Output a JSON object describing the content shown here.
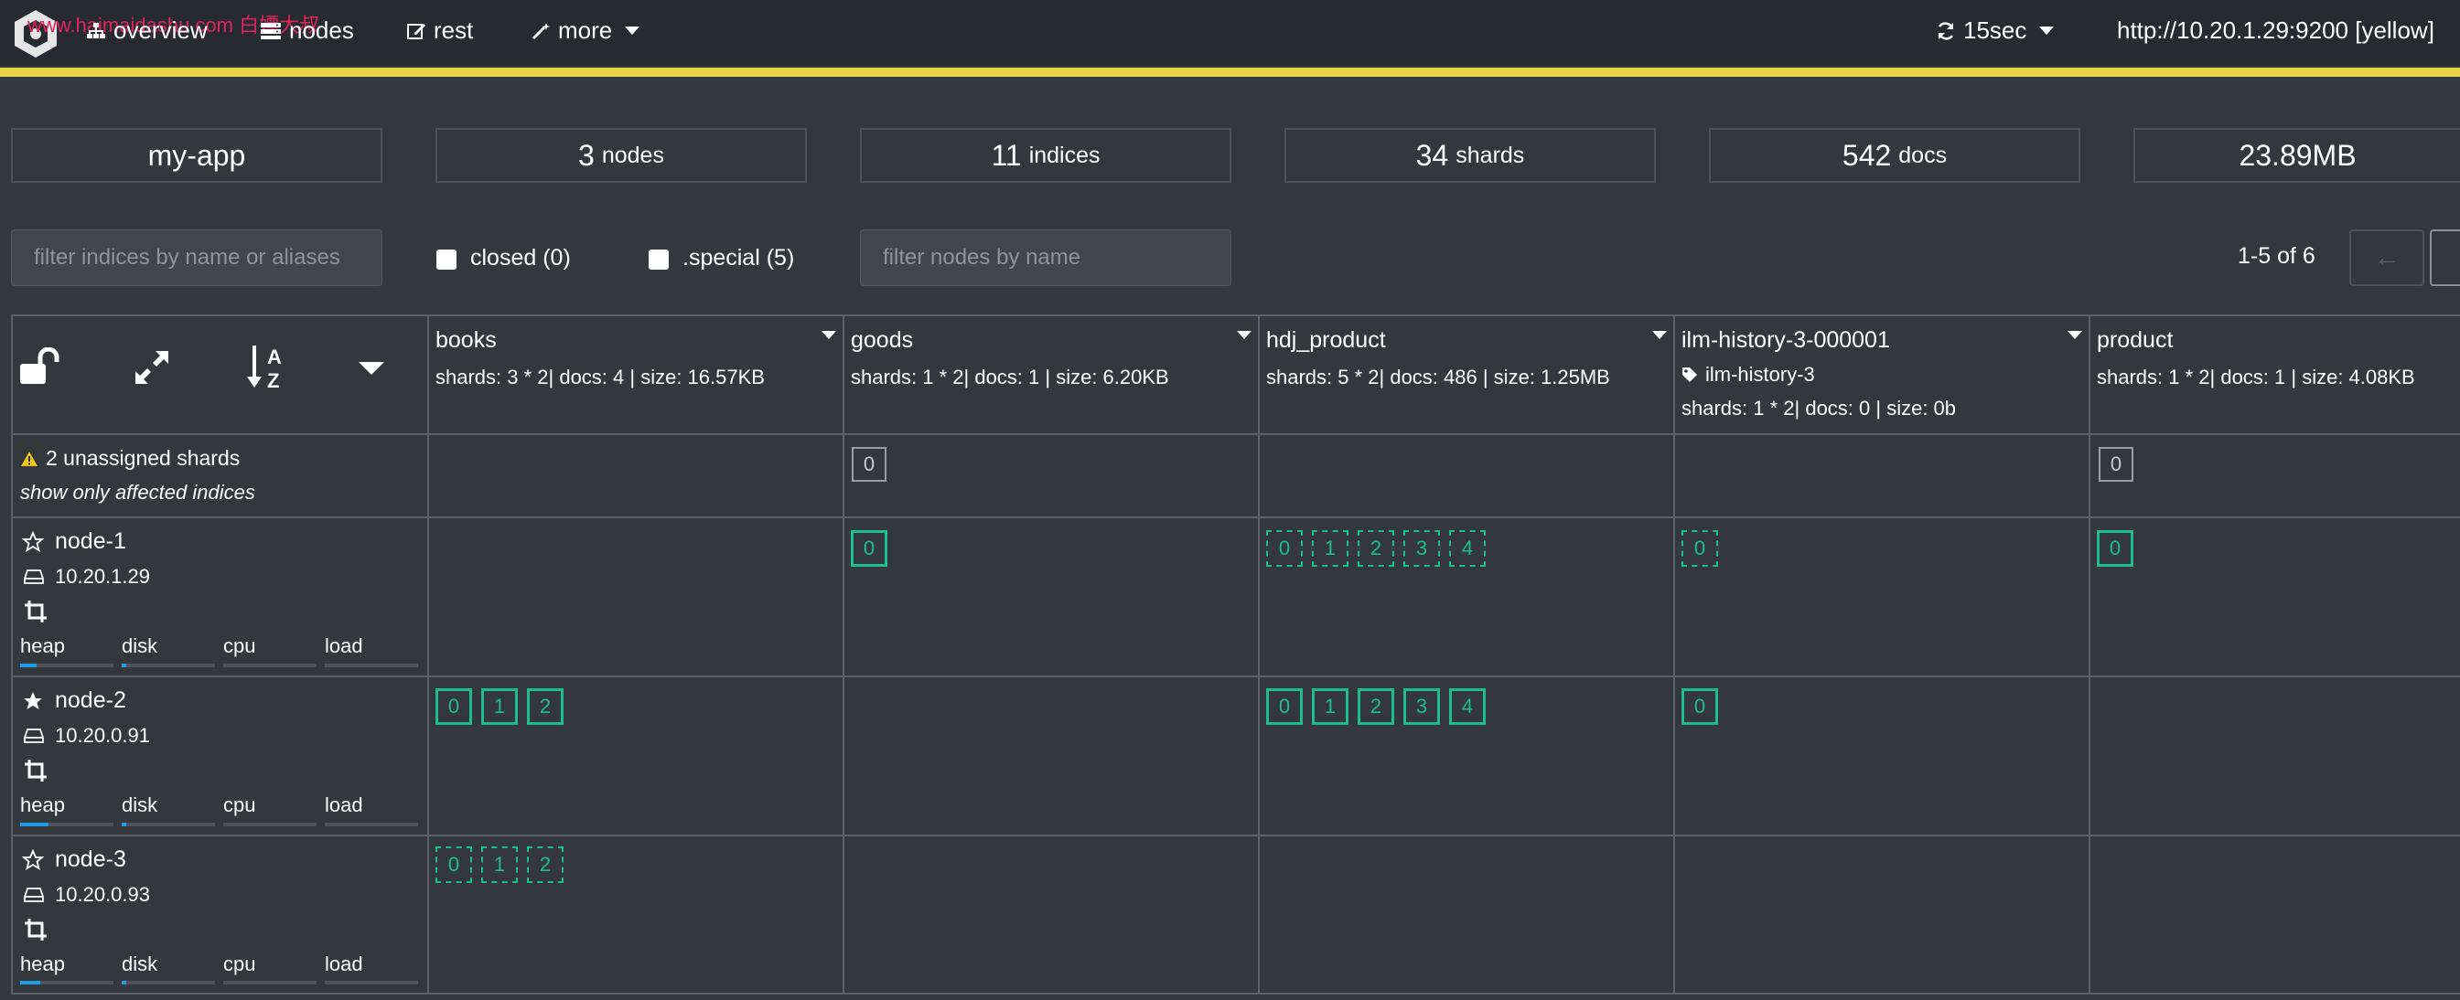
{
  "navbar": {
    "watermark": "www.haimaidashu.com 白嫖大叔",
    "items": [
      {
        "label": "overview",
        "icon": "sitemap-icon"
      },
      {
        "label": "nodes",
        "icon": "server-icon"
      },
      {
        "label": "rest",
        "icon": "edit-icon"
      },
      {
        "label": "more",
        "icon": "magic-wand-icon"
      }
    ],
    "refresh": "15sec",
    "cluster_url": "http://10.20.1.29:9200 [yellow]",
    "accent_color": "#e8d54a"
  },
  "stats": {
    "cluster_name": "my-app",
    "nodes_num": "3",
    "nodes_label": "nodes",
    "indices_num": "11",
    "indices_label": "indices",
    "shards_num": "34",
    "shards_label": "shards",
    "docs_num": "542",
    "docs_label": "docs",
    "size": "23.89MB"
  },
  "filters": {
    "indices_placeholder": "filter indices by name or aliases",
    "closed_label": "closed (0)",
    "special_label": ".special (5)",
    "nodes_placeholder": "filter nodes by name",
    "pager_text": "1-5 of 6",
    "prev_label": "←"
  },
  "indices": [
    {
      "name": "books",
      "stats": "shards: 3 * 2| docs: 4 | size: 16.57KB"
    },
    {
      "name": "goods",
      "stats": "shards: 1 * 2| docs: 1 | size: 6.20KB"
    },
    {
      "name": "hdj_product",
      "stats": "shards: 5 * 2| docs: 486 | size: 1.25MB"
    },
    {
      "name": "ilm-history-3-000001",
      "alias": "ilm-history-3",
      "stats": "shards: 1 * 2| docs: 0 | size: 0b"
    },
    {
      "name": "product",
      "stats": "shards: 1 * 2| docs: 1 | size: 4.08KB"
    }
  ],
  "unassigned": {
    "text": "2 unassigned shards",
    "link": "show only affected indices"
  },
  "nodes": [
    {
      "name": "node-1",
      "ip": "10.20.1.29",
      "master": false,
      "heap": 0.18,
      "disk": 0.05
    },
    {
      "name": "node-2",
      "ip": "10.20.0.91",
      "master": true,
      "heap": 0.3,
      "disk": 0.05
    },
    {
      "name": "node-3",
      "ip": "10.20.0.93",
      "master": false,
      "heap": 0.22,
      "disk": 0.05
    }
  ],
  "metrics": {
    "heap": "heap",
    "disk": "disk",
    "cpu": "cpu",
    "load": "load"
  },
  "shard_colors": {
    "assigned": "#1dbd8e",
    "unassigned": "#9aa0a6"
  },
  "shard_labels": [
    "0",
    "1",
    "2",
    "3",
    "4"
  ]
}
